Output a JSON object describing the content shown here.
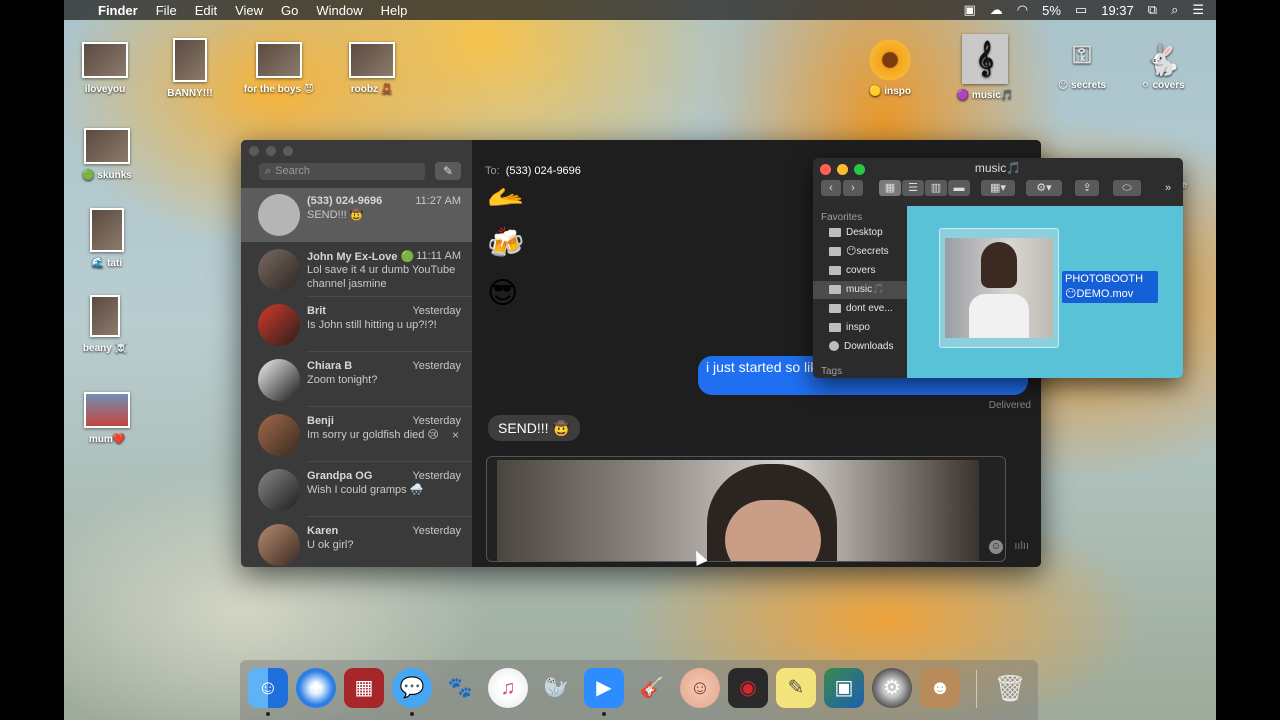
{
  "menubar": {
    "app_name": "Finder",
    "menus": [
      "File",
      "Edit",
      "View",
      "Go",
      "Window",
      "Help"
    ],
    "battery": "5%",
    "time": "19:37"
  },
  "desktop_icons": [
    {
      "label": "iloveyou"
    },
    {
      "label": "BANNY!!!"
    },
    {
      "label": "for the boys 😈"
    },
    {
      "label": "roobz 🧸"
    },
    {
      "label": "🟡 inspo"
    },
    {
      "label": "🟣 music🎵"
    },
    {
      "label": "😶 secrets"
    },
    {
      "label": "⚪ covers"
    },
    {
      "label": "🟢 skunks"
    },
    {
      "label": "🌊 tati"
    },
    {
      "label": "beany ☠️"
    },
    {
      "label": "mum❤️"
    },
    {
      "label": "me"
    }
  ],
  "messages": {
    "search_placeholder": "Search",
    "to_label": "To:",
    "to_value": "(533) 024-9696",
    "conversations": [
      {
        "name": "(533) 024-9696",
        "time": "11:27 AM",
        "preview": "SEND!!! 🤠"
      },
      {
        "name": "John My Ex-Love 🟢",
        "time": "11:11 AM",
        "preview": "Lol save it 4 ur dumb YouTube channel jasmine"
      },
      {
        "name": "Brit",
        "time": "Yesterday",
        "preview": "Is John still hitting u up?!?!"
      },
      {
        "name": "Chiara B",
        "time": "Yesterday",
        "preview": "Zoom tonight?"
      },
      {
        "name": "Benji",
        "time": "Yesterday",
        "preview": "Im sorry ur goldfish died 😢"
      },
      {
        "name": "Grandpa OG",
        "time": "Yesterday",
        "preview": "Wish I could gramps 🌨️"
      },
      {
        "name": "Karen",
        "time": "Yesterday",
        "preview": "U ok girl?"
      }
    ],
    "emojis": [
      "🫴",
      "🍻",
      "😎"
    ],
    "outgoing_text": "i just started so like...?",
    "delivered": "Delivered",
    "incoming_text": "SEND!!! 🤠"
  },
  "finder": {
    "title": "music🎵",
    "favorites_header": "Favorites",
    "tags_header": "Tags",
    "sidebar": [
      "Desktop",
      "😶secrets",
      "covers",
      "music🎵",
      "dont eve...",
      "inspo",
      "Downloads"
    ],
    "file_name": "PHOTOBOOTH 😶DEMO.mov"
  },
  "dock": {
    "apps": [
      "Finder",
      "Safari",
      "Photo Booth",
      "Messages",
      "Growl",
      "iTunes",
      "Seal",
      "Zoom",
      "GarageBand",
      "Face",
      "Photo Booth 2",
      "Stickies",
      "Preview",
      "System Preferences",
      "Contacts"
    ]
  }
}
